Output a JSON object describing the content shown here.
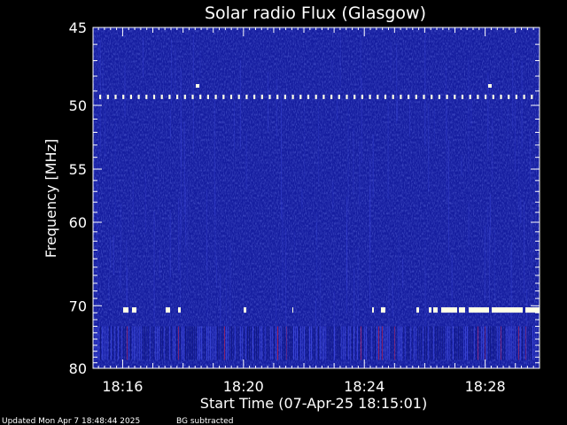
{
  "chart_data": {
    "type": "heatmap",
    "title": "Solar radio Flux (Glasgow)",
    "xlabel": "Start Time (07-Apr-25 18:15:01)",
    "ylabel": "Frequency [MHz]",
    "x_ticks": [
      "18:16",
      "18:20",
      "18:24",
      "18:28"
    ],
    "x_tick_minutes": [
      16,
      20,
      24,
      28
    ],
    "x_range_minutes": [
      15.02,
      29.8
    ],
    "y_ticks": [
      45,
      50,
      55,
      60,
      70,
      80
    ],
    "y_range_mhz": [
      45,
      80
    ],
    "y_scale": "reciprocal",
    "colors": {
      "background": "#000000",
      "spectrum_base": "#1a22b4",
      "spectrum_dark": "#0d1478",
      "spectrum_light": "#3d48e0",
      "burst": "#ffffe6",
      "red_noise": "#c0204a",
      "text": "#ffffff"
    },
    "features": [
      {
        "name": "rfi-dotted-line",
        "freq_mhz": 49.4
      },
      {
        "name": "rfi-line",
        "freq_mhz": 70.6
      },
      {
        "name": "noise-band",
        "freq_range_mhz": [
          73.0,
          78.5
        ]
      }
    ]
  },
  "footer": {
    "updated": "Updated Mon Apr  7 18:48:44 2025",
    "mode": "BG subtracted"
  }
}
